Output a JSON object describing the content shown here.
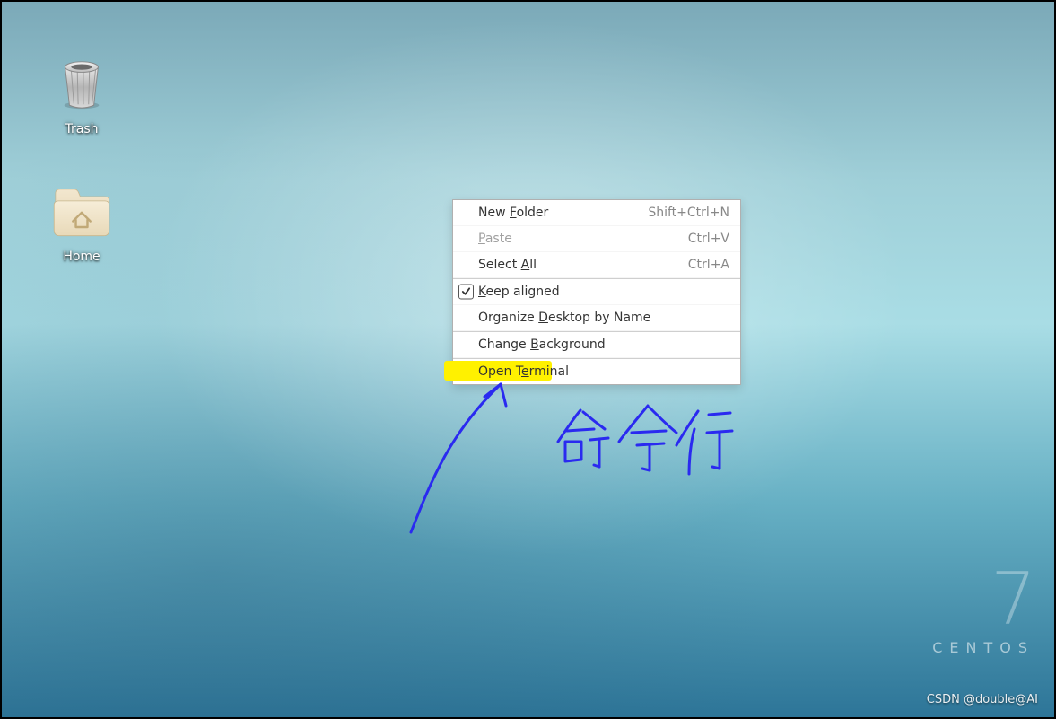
{
  "desktop": {
    "icons": [
      {
        "key": "trash",
        "label": "Trash"
      },
      {
        "key": "home",
        "label": "Home"
      }
    ]
  },
  "context_menu": {
    "items": {
      "new_folder": {
        "pre": "New ",
        "key": "F",
        "post": "older",
        "shortcut": "Shift+Ctrl+N",
        "enabled": true
      },
      "paste": {
        "pre": "",
        "key": "P",
        "post": "aste",
        "shortcut": "Ctrl+V",
        "enabled": false
      },
      "select_all": {
        "pre": "Select ",
        "key": "A",
        "post": "ll",
        "shortcut": "Ctrl+A",
        "enabled": true
      },
      "keep_aligned": {
        "pre": "",
        "key": "K",
        "post": "eep aligned",
        "shortcut": "",
        "enabled": true,
        "checked": true
      },
      "organize": {
        "pre": "Organize ",
        "key": "D",
        "post": "esktop by Name",
        "shortcut": "",
        "enabled": true
      },
      "change_bg": {
        "pre": "Change ",
        "key": "B",
        "post": "ackground",
        "shortcut": "",
        "enabled": true
      },
      "open_terminal": {
        "pre": "Open T",
        "key": "e",
        "post": "rminal",
        "shortcut": "",
        "enabled": true,
        "highlight": true
      }
    }
  },
  "watermark": {
    "big": "7",
    "word": "CENTOS"
  },
  "footer": "CSDN @double@AI",
  "annotation_text": "命令行",
  "colors": {
    "highlight": "#fff100",
    "ink": "#2a2af0"
  }
}
